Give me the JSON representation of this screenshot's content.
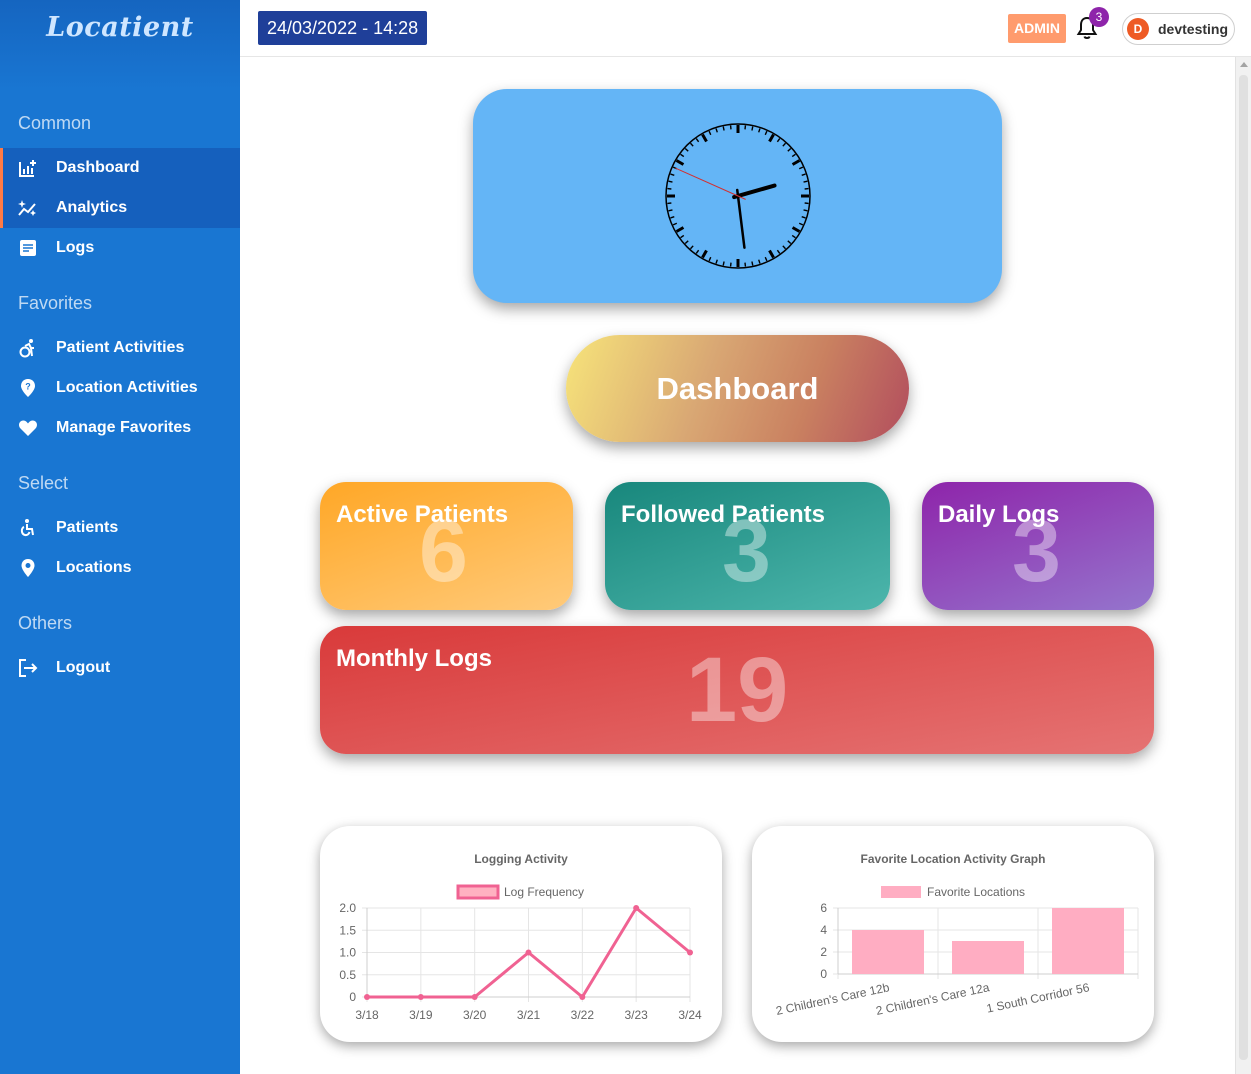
{
  "brand": "Locatient",
  "sidebar": {
    "sections": [
      {
        "title": "Common",
        "items": [
          {
            "label": "Dashboard",
            "icon": "dashboard-chart-icon",
            "active": true
          },
          {
            "label": "Analytics",
            "icon": "analytics-sparkle-icon",
            "active": true
          },
          {
            "label": "Logs",
            "icon": "document-icon",
            "active": false
          }
        ]
      },
      {
        "title": "Favorites",
        "items": [
          {
            "label": "Patient Activities",
            "icon": "accessible-forward-icon"
          },
          {
            "label": "Location Activities",
            "icon": "location-question-icon"
          },
          {
            "label": "Manage Favorites",
            "icon": "heart-icon"
          }
        ]
      },
      {
        "title": "Select",
        "items": [
          {
            "label": "Patients",
            "icon": "accessible-icon"
          },
          {
            "label": "Locations",
            "icon": "location-pin-icon"
          }
        ]
      },
      {
        "title": "Others",
        "items": [
          {
            "label": "Logout",
            "icon": "logout-icon"
          }
        ]
      }
    ]
  },
  "topbar": {
    "datetime": "24/03/2022 - 14:28",
    "role_badge": "ADMIN",
    "notification_count": "3",
    "user_initial": "D",
    "user_name": "devtesting"
  },
  "clock": {
    "hours": 2,
    "minutes": 28,
    "seconds": 49
  },
  "page_title": "Dashboard",
  "stats": {
    "active_patients": {
      "label": "Active Patients",
      "value": "6"
    },
    "followed_patients": {
      "label": "Followed Patients",
      "value": "3"
    },
    "daily_logs": {
      "label": "Daily Logs",
      "value": "3"
    },
    "monthly_logs": {
      "label": "Monthly Logs",
      "value": "19"
    }
  },
  "chart_data": [
    {
      "type": "line",
      "title": "Logging Activity",
      "legend": "top",
      "categories": [
        "3/18",
        "3/19",
        "3/20",
        "3/21",
        "3/22",
        "3/23",
        "3/24"
      ],
      "series": [
        {
          "name": "Log Frequency",
          "values": [
            0,
            0,
            0,
            1,
            0,
            2,
            1
          ]
        }
      ],
      "yticks": [
        "0",
        "0.5",
        "1.0",
        "1.5",
        "2.0"
      ],
      "ylim": [
        0,
        2
      ],
      "color": "#f06292",
      "grid": true
    },
    {
      "type": "bar",
      "title": "Favorite Location Activity Graph",
      "legend": "top",
      "categories": [
        "2 Children's Care 12b",
        "2 Children's Care 12a",
        "1 South Corridor 56"
      ],
      "series": [
        {
          "name": "Favorite Locations",
          "values": [
            4,
            3,
            6
          ]
        }
      ],
      "yticks": [
        "0",
        "2",
        "4",
        "6"
      ],
      "ylim": [
        0,
        6
      ],
      "color": "#ffadc2",
      "grid": true
    }
  ]
}
